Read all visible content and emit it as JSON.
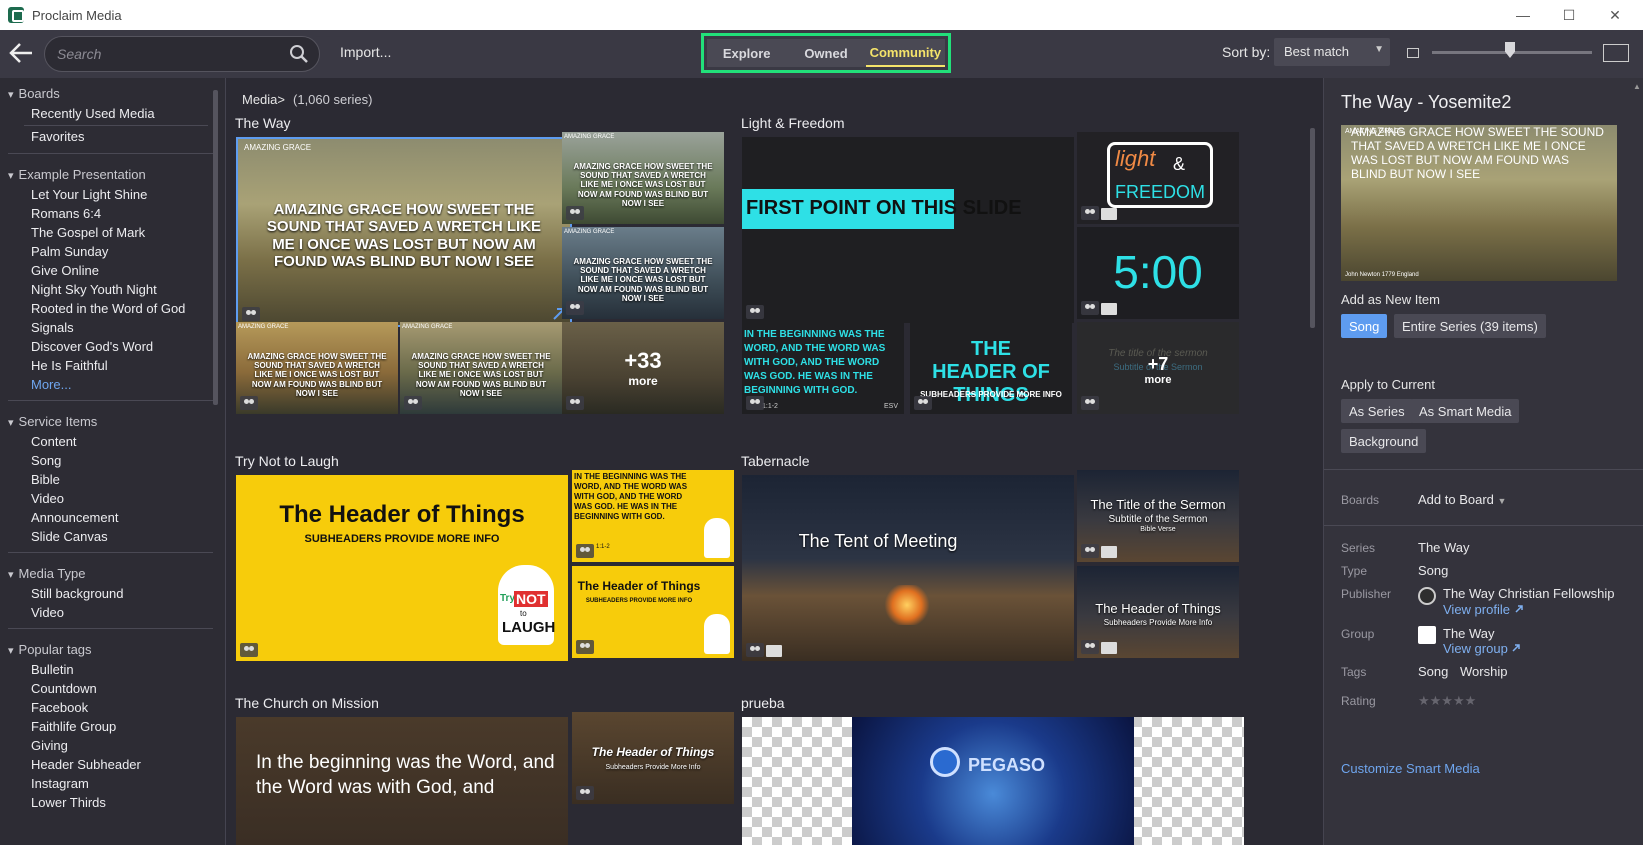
{
  "window": {
    "title": "Proclaim Media",
    "min": "—",
    "max": "☐",
    "close": "✕"
  },
  "toolbar": {
    "search_placeholder": "Search",
    "import_label": "Import...",
    "tabs": [
      "Explore",
      "Owned",
      "Community"
    ],
    "active_tab": "Community",
    "sort_label": "Sort by:",
    "sort_value": "Best match"
  },
  "sidebar": {
    "sections": [
      {
        "title": "Boards",
        "items": [
          "Recently Used Media",
          "Favorites"
        ]
      },
      {
        "title": "Example Presentation",
        "items": [
          "Let Your Light Shine",
          "Romans 6:4",
          "The Gospel of Mark",
          "Palm Sunday",
          "Give Online",
          "Night Sky Youth Night",
          "Rooted in the Word of God",
          "Signals",
          "Discover God's Word",
          "He Is Faithful"
        ],
        "more": "More..."
      },
      {
        "title": "Service Items",
        "items": [
          "Content",
          "Song",
          "Bible",
          "Video",
          "Announcement",
          "Slide Canvas"
        ]
      },
      {
        "title": "Media Type",
        "items": [
          "Still background",
          "Video"
        ]
      },
      {
        "title": "Popular tags",
        "items": [
          "Bulletin",
          "Countdown",
          "Facebook",
          "Faithlife Group",
          "Giving",
          "Header Subheader",
          "Instagram",
          "Lower Thirds"
        ]
      }
    ]
  },
  "main": {
    "breadcrumb": "Media",
    "breadcrumb_sep": ">",
    "series_count": "(1,060 series)",
    "series": [
      {
        "title": "The Way"
      },
      {
        "title": "Light & Freedom"
      },
      {
        "title": "Try Not to Laugh"
      },
      {
        "title": "Tabernacle"
      },
      {
        "title": "The Church on Mission"
      },
      {
        "title": "prueba"
      }
    ],
    "the_way": {
      "label": "AMAZING GRACE",
      "lyrics": "AMAZING GRACE HOW SWEET THE SOUND THAT SAVED A WRETCH LIKE ME I ONCE WAS LOST BUT NOW AM FOUND WAS BLIND BUT NOW I SEE",
      "more_count": "+33",
      "more_label": "more"
    },
    "light_freedom": {
      "point": "FIRST POINT ON THIS SLIDE",
      "logo_light": "light",
      "logo_amp": "&",
      "logo_freedom": "FREEDOM",
      "timer": "5:00",
      "verse": "IN THE BEGINNING WAS THE WORD, AND THE WORD WAS WITH GOD, AND THE WORD WAS GOD. HE WAS IN THE BEGINNING WITH GOD.",
      "verse_ref": "1:1-2",
      "verse_tag": "ESV",
      "header": "THE HEADER OF THINGS",
      "subheader": "SUBHEADERS PROVIDE MORE INFO",
      "faded_title": "The title of the sermon",
      "faded_sub": "Subtitle of the Sermon",
      "more_count": "+7",
      "more_label": "more"
    },
    "try_not_to_laugh": {
      "header": "The Header of Things",
      "subheader": "SUBHEADERS PROVIDE MORE INFO",
      "verse": "IN THE BEGINNING WAS THE WORD, AND THE WORD WAS WITH GOD, AND THE WORD WAS GOD. HE WAS IN THE BEGINNING WITH GOD.",
      "verse_ref": "1:1-2",
      "logo_try": "Try",
      "logo_not": "NOT",
      "logo_to": "to",
      "logo_laugh": "LAUGH"
    },
    "tabernacle": {
      "main": "The Tent of Meeting",
      "title": "The Title of the Sermon",
      "subtitle": "Subtitle of the Sermon",
      "ref": "Bible Verse",
      "header": "The Header of Things",
      "subheader": "Subheaders Provide More Info"
    },
    "church_on_mission": {
      "verse": "In the beginning was the Word, and the Word was with God, and",
      "header": "The Header of Things",
      "subheader": "Subheaders Provide More Info"
    },
    "prueba": {
      "logo": "PEGASO"
    }
  },
  "detail": {
    "title": "The Way - Yosemite2",
    "thumb_label": "AMAZING GRACE",
    "thumb_lyrics": "AMAZING GRACE HOW SWEET THE SOUND THAT SAVED A WRETCH LIKE ME I ONCE WAS LOST BUT NOW AM FOUND WAS BLIND BUT NOW I SEE",
    "thumb_credit": "John Newton 1779 England",
    "add_heading": "Add as New Item",
    "add_song": "Song",
    "add_series": "Entire Series (39 items)",
    "apply_heading": "Apply to Current",
    "as_series": "As Series",
    "as_smart": "As Smart Media",
    "background": "Background",
    "boards_key": "Boards",
    "add_to_board": "Add to Board",
    "series_key": "Series",
    "series_val": "The Way",
    "type_key": "Type",
    "type_val": "Song",
    "publisher_key": "Publisher",
    "publisher_val": "The Way Christian Fellowship",
    "view_profile": "View profile",
    "group_key": "Group",
    "group_val": "The Way",
    "view_group": "View group",
    "tags_key": "Tags",
    "tags_val": [
      "Song",
      "Worship"
    ],
    "rating_key": "Rating",
    "rating_stars": "★★★★★",
    "rating_value": 0,
    "customize": "Customize Smart Media"
  },
  "colors": {
    "accent": "#5e9cf0",
    "highlight_border": "#22e07a",
    "active_tab": "#f4e36a",
    "yellow_bg": "#f7cc0b",
    "cyan": "#2ee0e6"
  },
  "icons": [
    "back-arrow-icon",
    "search-icon",
    "chevron-down-icon",
    "people-icon",
    "video-icon",
    "external-link-icon"
  ]
}
